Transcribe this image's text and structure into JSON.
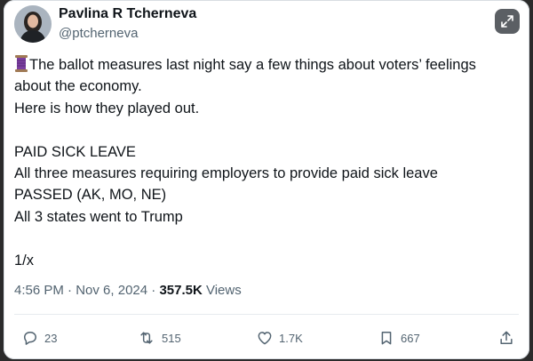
{
  "author": {
    "name": "Pavlina R Tcherneva",
    "handle": "@ptcherneva",
    "avatar_icon": "profile-photo"
  },
  "expand_icon": "expand-arrows-icon",
  "tweet": {
    "lines": [
      "The ballot measures last night say a few things about voters’ feelings",
      "about the economy.",
      "Here is how they played out.",
      "",
      "PAID SICK LEAVE",
      "All three measures requiring employers to provide paid sick leave",
      "PASSED (AK, MO, NE)",
      "All 3 states  went to Trump",
      "",
      "1/x"
    ],
    "lead_icon": "thread-spool-icon"
  },
  "meta": {
    "time": "4:56 PM",
    "separator": " · ",
    "date": "Nov 6, 2024",
    "views_count": "357.5K",
    "views_label": " Views"
  },
  "actions": {
    "replies": "23",
    "reposts": "515",
    "likes": "1.7K",
    "bookmarks": "667"
  },
  "colors": {
    "text": "#0f1419",
    "muted": "#536471",
    "divider": "#e7ebef"
  }
}
